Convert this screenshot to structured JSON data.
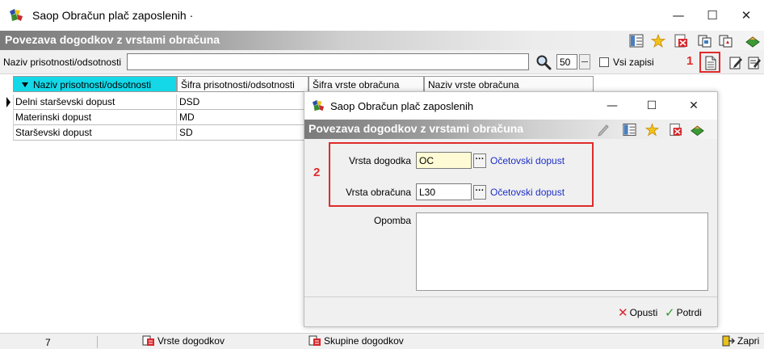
{
  "window": {
    "title": "Saop Obračun plač zaposlenih",
    "title_suffix": "·",
    "minimize": "—",
    "maximize": "☐",
    "close": "✕"
  },
  "header": {
    "title": "Povezava dogodkov z vrstami obračuna"
  },
  "filter": {
    "label": "Naziv prisotnosti/odsotnosti",
    "value": "",
    "count": "50",
    "all_records_label": "Vsi zapisi",
    "annotation": "1"
  },
  "grid": {
    "columns": [
      "Naziv prisotnosti/odsotnosti",
      "Šifra prisotnosti/odsotnosti",
      "Šifra vrste obračuna",
      "Naziv vrste obračuna"
    ],
    "rows": [
      {
        "name": "Delni starševski dopust",
        "code": "DSD"
      },
      {
        "name": "Materinski dopust",
        "code": "MD"
      },
      {
        "name": "Starševski dopust",
        "code": "SD"
      }
    ]
  },
  "status": {
    "count": "7",
    "event_types": "Vrste dogodkov",
    "event_groups": "Skupine dogodkov",
    "close": "Zapri"
  },
  "dialog": {
    "title": "Saop Obračun plač zaposlenih",
    "header_title": "Povezava dogodkov z vrstami obračuna",
    "annotation": "2",
    "event_type_label": "Vrsta dogodka",
    "event_type_value": "OC",
    "event_type_name": "Očetovski dopust",
    "calc_type_label": "Vrsta obračuna",
    "calc_type_value": "L30",
    "calc_type_name": "Očetovski dopust",
    "note_label": "Opomba",
    "note_value": "",
    "dots": "···",
    "cancel_label": "Opusti",
    "confirm_label": "Potrdi",
    "cancel_icon": "✕",
    "confirm_icon": "✓",
    "accent_red": "#e02b2b",
    "link_blue": "#1d2fc7"
  }
}
